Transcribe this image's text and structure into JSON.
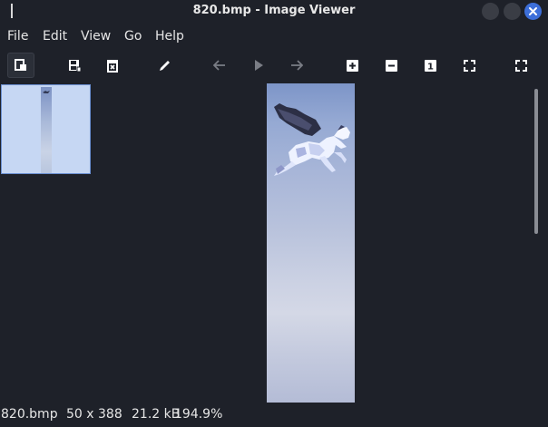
{
  "window": {
    "title": "820.bmp - Image Viewer"
  },
  "menu": {
    "file": "File",
    "edit": "Edit",
    "view": "View",
    "go": "Go",
    "help": "Help"
  },
  "toolbar": {
    "icons": [
      "open-icon",
      "save-icon",
      "delete-icon",
      "edit-icon",
      "back-icon",
      "play-icon",
      "forward-icon",
      "zoom-in-icon",
      "zoom-out-icon",
      "zoom-original-icon",
      "zoom-fit-icon",
      "fullscreen-icon"
    ],
    "zoom_original_glyph": "1"
  },
  "statusbar": {
    "filename": "820.bmp",
    "dimensions": "50 x 388",
    "filesize": "21.2 kB",
    "zoom": "194.9%"
  },
  "colors": {
    "background": "#1e2129",
    "accent": "#3d6fd9",
    "thumbnail_selected": "#c6d7f3"
  }
}
